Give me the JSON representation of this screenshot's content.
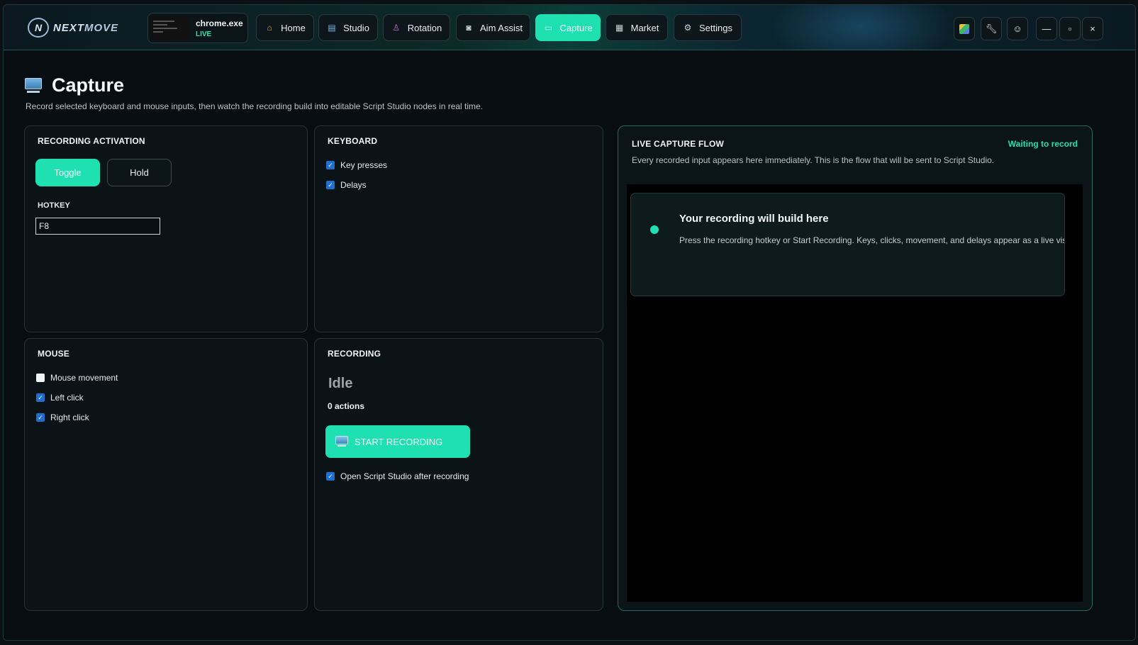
{
  "app": {
    "logo_letter": "N",
    "logo_text_a": "NEXT",
    "logo_text_b": "MOVE"
  },
  "process": {
    "name": "chrome.exe",
    "status": "LIVE"
  },
  "nav": {
    "tabs": [
      {
        "label": "Home",
        "icon": "home-icon"
      },
      {
        "label": "Studio",
        "icon": "studio-icon"
      },
      {
        "label": "Rotation",
        "icon": "joystick-icon"
      },
      {
        "label": "Aim Assist",
        "icon": "camera-icon"
      },
      {
        "label": "Capture",
        "icon": "monitor-icon",
        "active": true
      },
      {
        "label": "Market",
        "icon": "market-icon"
      },
      {
        "label": "Settings",
        "icon": "gear-icon"
      }
    ]
  },
  "window_controls": {
    "minimize": "—",
    "maximize": "▫",
    "close": "×"
  },
  "page": {
    "title": "Capture",
    "subtitle": "Record selected keyboard and mouse inputs, then watch the recording build into editable Script Studio nodes in real time."
  },
  "activation": {
    "title": "RECORDING ACTIVATION",
    "toggle_label": "Toggle",
    "hold_label": "Hold",
    "selected": "Toggle",
    "hotkey_label": "HOTKEY",
    "hotkey_value": "F8"
  },
  "keyboard": {
    "title": "KEYBOARD",
    "options": [
      {
        "label": "Key presses",
        "checked": true
      },
      {
        "label": "Delays",
        "checked": true
      }
    ]
  },
  "mouse": {
    "title": "MOUSE",
    "options": [
      {
        "label": "Mouse movement",
        "checked": false
      },
      {
        "label": "Left click",
        "checked": true
      },
      {
        "label": "Right click",
        "checked": true
      }
    ]
  },
  "recording": {
    "title": "RECORDING",
    "state": "Idle",
    "actions": "0 actions",
    "start_label": "START RECORDING",
    "open_studio_label": "Open Script Studio after recording",
    "open_studio_checked": true
  },
  "flow": {
    "title": "LIVE CAPTURE FLOW",
    "status": "Waiting to record",
    "description": "Every recorded input appears here immediately. This is the flow that will be sent to Script Studio.",
    "empty_title": "Your recording will build here",
    "empty_desc": "Press the recording hotkey or Start Recording. Keys, clicks, movement, and delays appear as a live visual flo"
  },
  "colors": {
    "accent": "#1ee0b1",
    "checkbox": "#1e6fd0",
    "background": "#070d10"
  }
}
